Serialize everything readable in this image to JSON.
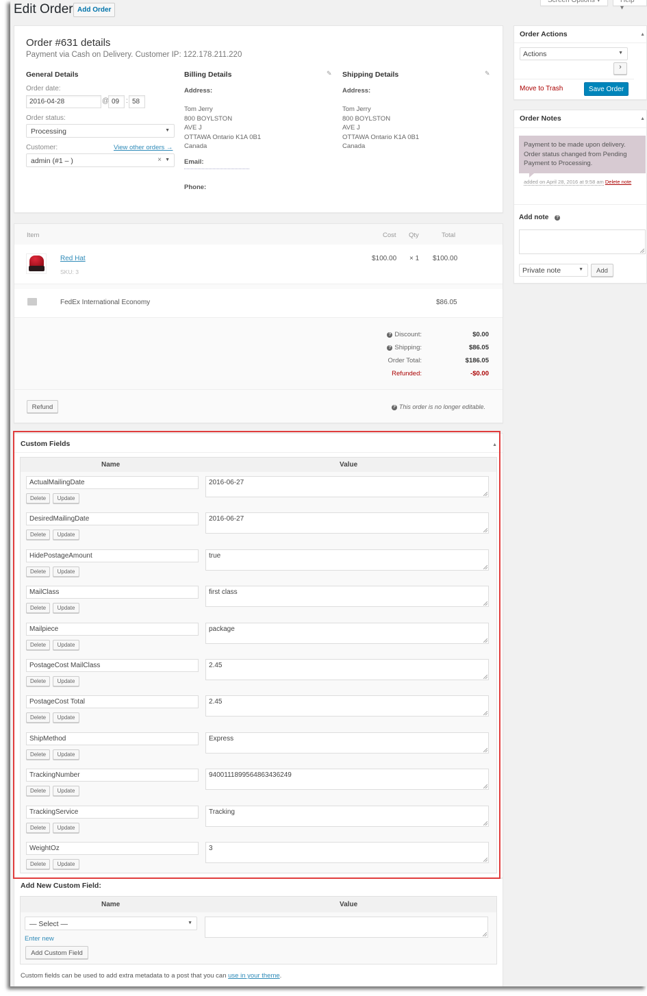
{
  "header": {
    "title": "Edit Order",
    "add_order": "Add Order",
    "screen_options": "Screen Options ▾",
    "help": "Help ▾"
  },
  "order": {
    "heading": "Order #631 details",
    "subheading": "Payment via Cash on Delivery. Customer IP: 122.178.211.220",
    "general": {
      "title": "General Details",
      "date_label": "Order date:",
      "date": "2016-04-28",
      "at": "@",
      "hour": "09",
      "colon": ":",
      "minute": "58",
      "status_label": "Order status:",
      "status": "Processing",
      "customer_label": "Customer:",
      "view_other": "View other orders →",
      "customer": "admin (#1 –                        )",
      "clear": "×"
    },
    "billing": {
      "title": "Billing Details",
      "address_label": "Address:",
      "lines": [
        "Tom Jerry",
        "800 BOYLSTON",
        "AVE J",
        "OTTAWA Ontario K1A 0B1",
        "Canada"
      ],
      "email_label": "Email:",
      "phone_label": "Phone:"
    },
    "shipping": {
      "title": "Shipping Details",
      "address_label": "Address:",
      "lines": [
        "Tom Jerry",
        "800 BOYLSTON",
        "AVE J",
        "OTTAWA Ontario K1A 0B1",
        "Canada"
      ]
    }
  },
  "items": {
    "headers": {
      "item": "Item",
      "cost": "Cost",
      "qty": "Qty",
      "total": "Total"
    },
    "product": {
      "name": "Red Hat",
      "sku": "SKU: 3",
      "cost": "$100.00",
      "qty": "× 1",
      "total": "$100.00"
    },
    "shipping": {
      "name": "FedEx International Economy",
      "total": "$86.05"
    },
    "totals": [
      {
        "label": "Discount:",
        "value": "$0.00",
        "help": true
      },
      {
        "label": "Shipping:",
        "value": "$86.05",
        "help": true
      },
      {
        "label": "Order Total:",
        "value": "$186.05",
        "help": false
      },
      {
        "label": "Refunded:",
        "value": "-$0.00",
        "help": false,
        "refund": true
      }
    ],
    "refund_button": "Refund",
    "not_editable": "This order is no longer editable."
  },
  "custom_fields": {
    "title": "Custom Fields",
    "name_header": "Name",
    "value_header": "Value",
    "delete_label": "Delete",
    "update_label": "Update",
    "rows": [
      {
        "name": "ActualMailingDate",
        "value": "2016-06-27"
      },
      {
        "name": "DesiredMailingDate",
        "value": "2016-06-27"
      },
      {
        "name": "HidePostageAmount",
        "value": "true"
      },
      {
        "name": "MailClass",
        "value": "first class"
      },
      {
        "name": "Mailpiece",
        "value": "package"
      },
      {
        "name": "PostageCost MailClass",
        "value": "2.45"
      },
      {
        "name": "PostageCost Total",
        "value": "2.45"
      },
      {
        "name": "ShipMethod",
        "value": "Express"
      },
      {
        "name": "TrackingNumber",
        "value": "9400111899564863436249"
      },
      {
        "name": "TrackingService",
        "value": "Tracking"
      },
      {
        "name": "WeightOz",
        "value": "3"
      }
    ],
    "add_new": {
      "title": "Add New Custom Field:",
      "name_header": "Name",
      "value_header": "Value",
      "select": "— Select —",
      "enter_new": "Enter new",
      "button": "Add Custom Field",
      "footer_text": "Custom fields can be used to add extra metadata to a post that you can ",
      "footer_link": "use in your theme",
      "footer_end": "."
    },
    "highlight_color": "#e03c3c"
  },
  "sidebar": {
    "order_actions": {
      "title": "Order Actions",
      "select": "Actions",
      "go": "›",
      "trash": "Move to Trash",
      "save": "Save Order"
    },
    "order_notes": {
      "title": "Order Notes",
      "note_text": "Payment to be made upon delivery. Order status changed from Pending Payment to Processing.",
      "meta": "added on April 28, 2016 at 9:58 am",
      "delete": "Delete note",
      "add_note_label": "Add note",
      "note_type": "Private note",
      "add_button": "Add"
    }
  },
  "colors": {
    "primary": "#0085ba",
    "link": "#2e8ab8",
    "danger": "#a00",
    "note_bg": "#d7cad2"
  }
}
